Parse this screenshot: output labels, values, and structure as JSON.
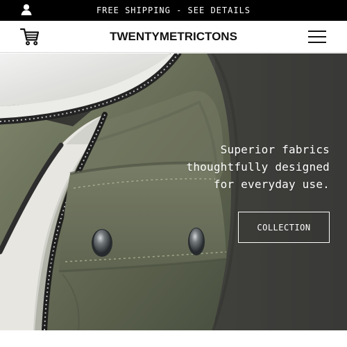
{
  "announcement": {
    "text": "FREE SHIPPING - SEE DETAILS",
    "account_icon": "user-icon",
    "background_color": "#000000",
    "text_color": "#ffffff"
  },
  "header": {
    "logo_text": "TWENTYMETRICTONS",
    "cart_icon": "shopping-cart-icon",
    "menu_icon": "hamburger-menu-icon"
  },
  "hero": {
    "headline_lines": [
      "Superior fabrics",
      "thoughtfully designed",
      "for everyday use."
    ],
    "button_label": "COLLECTION",
    "image": "olive-jacket-closeup-image"
  }
}
